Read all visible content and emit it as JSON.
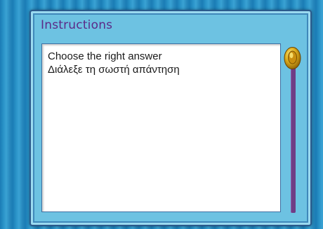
{
  "window": {
    "title": "Instructions"
  },
  "instructions": {
    "lines": [
      "Choose the right answer",
      "Διάλεξε τη σωστή απάντηση"
    ]
  },
  "colors": {
    "title": "#5b2a88",
    "panel": "#6dc2e2",
    "scroll_track": "#6f3c86",
    "scroll_knob": "#d4a017"
  },
  "icons": {
    "scroll_knob": "gold-ring-scroll-knob-icon"
  }
}
